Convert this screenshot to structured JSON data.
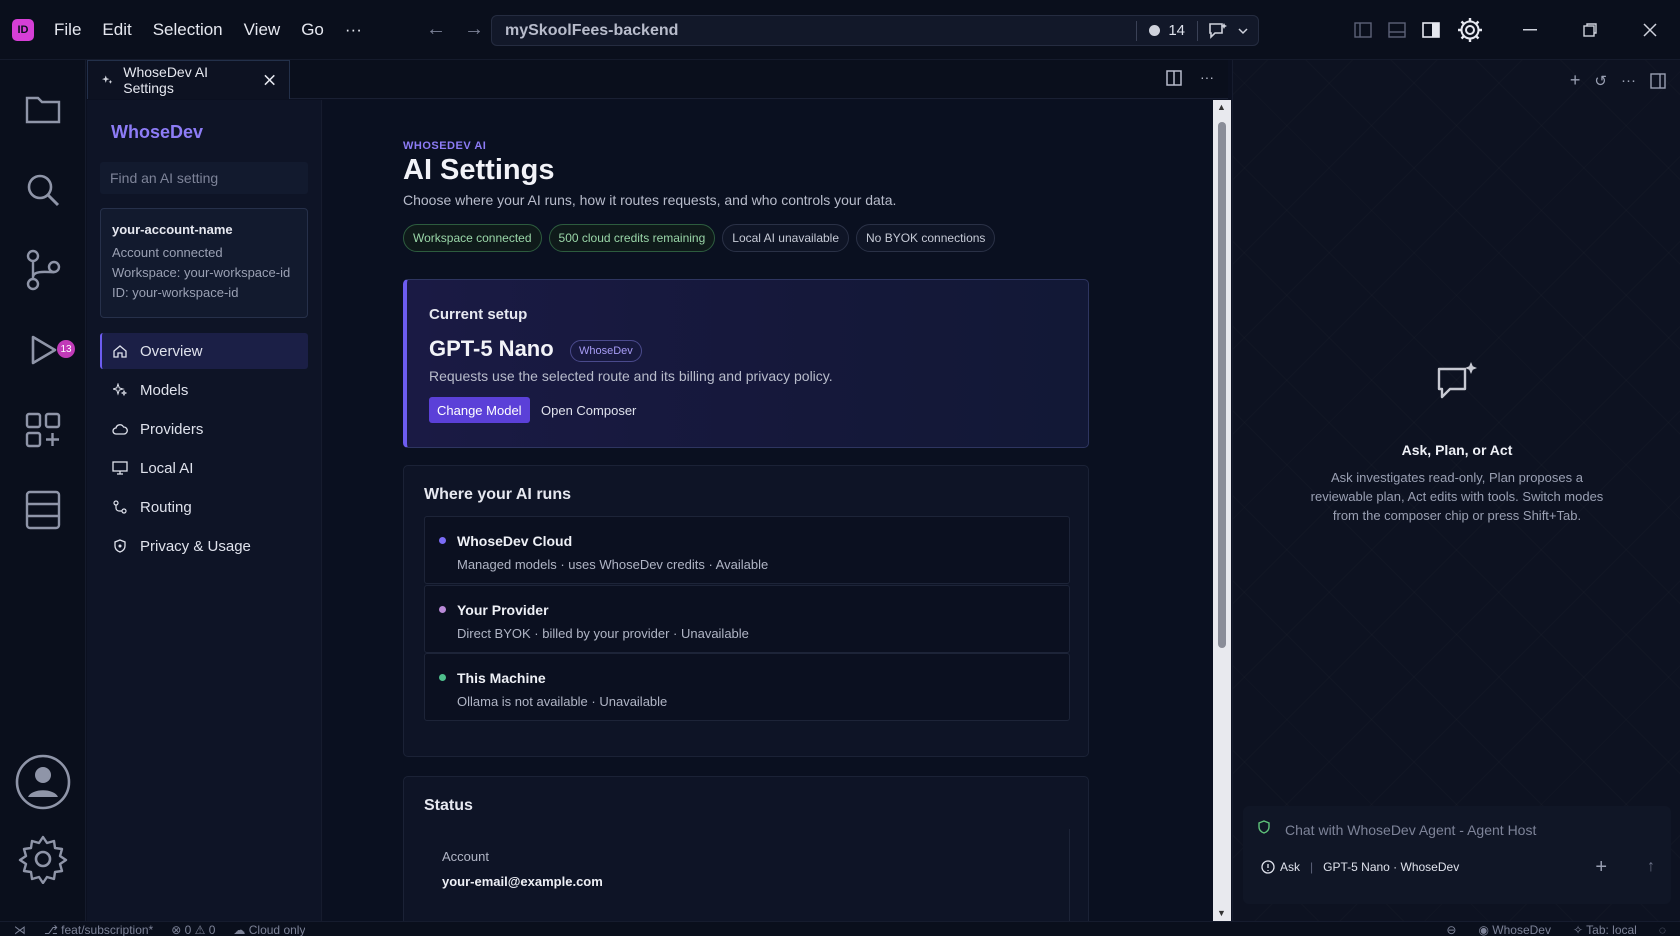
{
  "titlebar": {
    "logo": "ID",
    "menu": [
      "File",
      "Edit",
      "Selection",
      "View",
      "Go",
      "···"
    ],
    "command_center": "mySkoolFees-backend",
    "count": "14"
  },
  "activity": {
    "scm_badge": "13"
  },
  "tab": {
    "label": "WhoseDev AI Settings"
  },
  "sidebar": {
    "brand": "WhoseDev",
    "search_placeholder": "Find an AI setting",
    "account": {
      "name": "your-account-name",
      "status": "Account connected",
      "workspace": "Workspace: your-workspace-id",
      "id": "ID: your-workspace-id"
    },
    "nav": [
      {
        "label": "Overview",
        "icon": "home-icon"
      },
      {
        "label": "Models",
        "icon": "sparkle-icon"
      },
      {
        "label": "Providers",
        "icon": "cloud-icon"
      },
      {
        "label": "Local AI",
        "icon": "monitor-icon"
      },
      {
        "label": "Routing",
        "icon": "route-icon"
      },
      {
        "label": "Privacy & Usage",
        "icon": "shield-icon"
      }
    ]
  },
  "main": {
    "eyebrow": "WHOSEDEV AI",
    "title": "AI Settings",
    "subtitle": "Choose where your AI runs, how it routes requests, and who controls your data.",
    "chips": [
      "Workspace connected",
      "500 cloud credits remaining",
      "Local AI unavailable",
      "No BYOK connections"
    ],
    "setup": {
      "label": "Current setup",
      "model": "GPT-5 Nano",
      "tag": "WhoseDev",
      "desc": "Requests use the selected route and its billing and privacy policy.",
      "change_btn": "Change Model",
      "open_btn": "Open Composer"
    },
    "runs": {
      "title": "Where your AI runs",
      "items": [
        {
          "name": "WhoseDev Cloud",
          "desc": "Managed models · uses WhoseDev credits · Available",
          "color": "#7b6cf6"
        },
        {
          "name": "Your Provider",
          "desc": "Direct BYOK · billed by your provider · Unavailable",
          "color": "#b98ad8"
        },
        {
          "name": "This Machine",
          "desc": "Ollama is not available · Unavailable",
          "color": "#4fc08d"
        }
      ]
    },
    "status": {
      "title": "Status",
      "label": "Account",
      "value": "your-email@example.com"
    }
  },
  "right": {
    "title": "Ask, Plan, or Act",
    "desc": "Ask investigates read-only, Plan proposes a reviewable plan, Act edits with tools. Switch modes from the composer chip or press Shift+Tab.",
    "composer_placeholder": "Chat with WhoseDev Agent - Agent Host",
    "mode": "Ask",
    "model": "GPT-5 Nano · WhoseDev"
  },
  "statusbar": {
    "branch": "feat/subscription*",
    "problems": "⊗ 0 ⚠ 0",
    "cloud": "Cloud only",
    "account": "WhoseDev",
    "tab": "Tab: local"
  }
}
